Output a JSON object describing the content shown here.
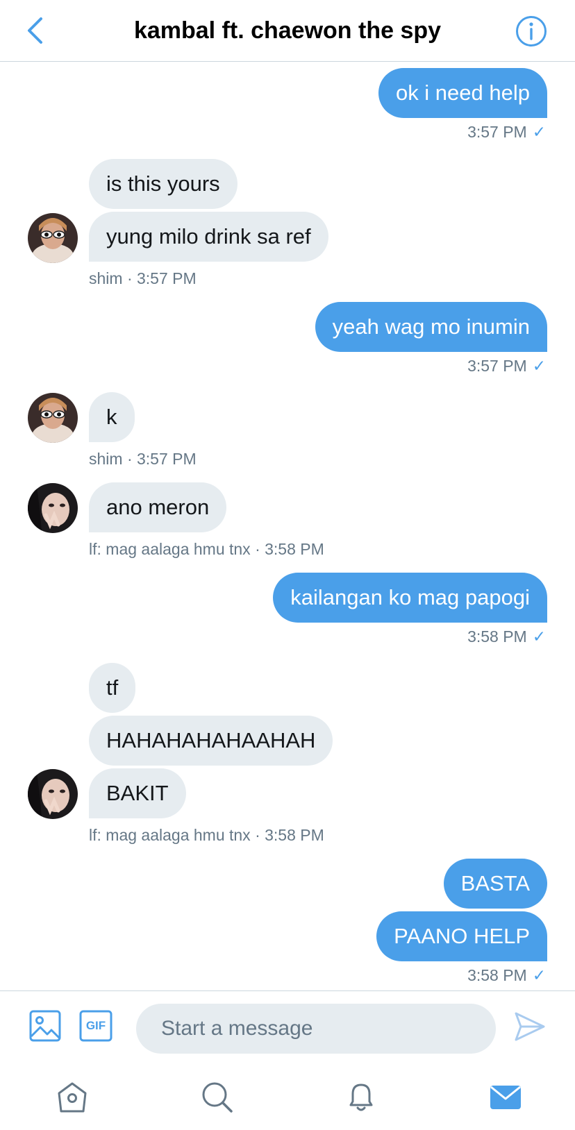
{
  "header": {
    "title": "kambal ft. chaewon the spy",
    "back_icon": "chevron-left-icon",
    "info_icon": "info-icon"
  },
  "colors": {
    "accent": "#4a9fe9",
    "incoming_bubble": "#e6ecf0",
    "meta_text": "#657786"
  },
  "messages": [
    {
      "text": "ok i need help"
    },
    {
      "meta": "3:57 PM"
    },
    {
      "text": "is this yours"
    },
    {
      "text": "yung milo drink sa ref"
    },
    {
      "meta": "shim · 3:57 PM"
    },
    {
      "text": "yeah wag mo inumin"
    },
    {
      "meta": "3:57 PM"
    },
    {
      "text": "k"
    },
    {
      "meta": "shim · 3:57 PM"
    },
    {
      "text": "ano meron"
    },
    {
      "meta": "lf: mag aalaga hmu tnx · 3:58 PM"
    },
    {
      "text": "kailangan ko mag papogi"
    },
    {
      "meta": "3:58 PM"
    },
    {
      "text": "tf"
    },
    {
      "text": "HAHAHAHAHAAHAH"
    },
    {
      "text": "BAKIT"
    },
    {
      "meta": "lf: mag aalaga hmu tnx · 3:58 PM"
    },
    {
      "text": "BASTA"
    },
    {
      "text": "PAANO HELP"
    },
    {
      "meta": "3:58 PM"
    }
  ],
  "read_mark": "✓",
  "composer": {
    "placeholder": "Start a message",
    "gif_label": "GIF"
  },
  "tabbar": [
    "home-icon",
    "search-icon",
    "bell-icon",
    "mail-icon"
  ]
}
